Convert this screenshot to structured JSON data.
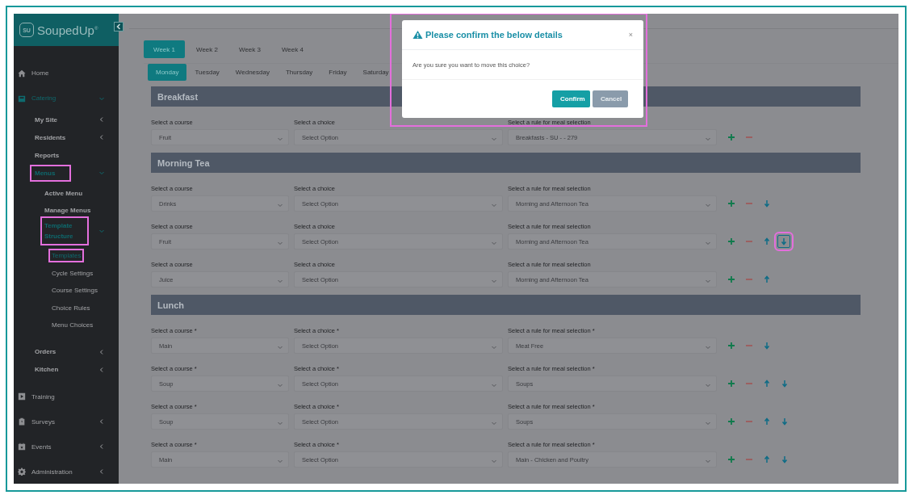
{
  "logo": {
    "badge": "SU",
    "name": "SoupedUp",
    "mark": "®"
  },
  "sidebar": {
    "items": [
      {
        "label": "Home",
        "active": false
      },
      {
        "label": "Catering",
        "active": true,
        "expanded": true,
        "children": [
          {
            "label": "My Site",
            "active": false,
            "expanded": false
          },
          {
            "label": "Residents",
            "active": false,
            "expanded": false
          },
          {
            "label": "Reports",
            "active": false
          },
          {
            "label": "Menus",
            "active": true,
            "expanded": true,
            "highlighted": true,
            "children": [
              {
                "label": "Active Menu",
                "active": false
              },
              {
                "label": "Manage Menus",
                "active": false
              },
              {
                "label": "Template Structure",
                "active": true,
                "expanded": true,
                "highlighted": true,
                "children": [
                  {
                    "label": "Templates",
                    "active": true,
                    "highlighted": true
                  },
                  {
                    "label": "Cycle Settings",
                    "active": false
                  },
                  {
                    "label": "Course Settings",
                    "active": false
                  },
                  {
                    "label": "Choice Rules",
                    "active": false
                  },
                  {
                    "label": "Menu Choices",
                    "active": false
                  }
                ]
              }
            ]
          },
          {
            "label": "Orders",
            "active": false,
            "expanded": false
          },
          {
            "label": "Kitchen",
            "active": false,
            "expanded": false
          }
        ]
      },
      {
        "label": "Training",
        "active": false
      },
      {
        "label": "Surveys",
        "active": false,
        "expanded": false
      },
      {
        "label": "Events",
        "active": false,
        "expanded": false
      },
      {
        "label": "Administration",
        "active": false,
        "expanded": false
      }
    ]
  },
  "week_tabs": [
    {
      "label": "Week 1",
      "selected": true
    },
    {
      "label": "Week 2",
      "selected": false
    },
    {
      "label": "Week 3",
      "selected": false
    },
    {
      "label": "Week 4",
      "selected": false
    }
  ],
  "day_tabs": [
    {
      "label": "Monday",
      "selected": true
    },
    {
      "label": "Tuesday",
      "selected": false
    },
    {
      "label": "Wednesday",
      "selected": false
    },
    {
      "label": "Thursday",
      "selected": false
    },
    {
      "label": "Friday",
      "selected": false
    },
    {
      "label": "Saturday",
      "selected": false
    }
  ],
  "sections": [
    {
      "title": "Breakfast",
      "rows": [
        {
          "course_label": "Select a course",
          "course": "Fruit",
          "choice_label": "Select a choice",
          "choice": "Select Option",
          "rule_label": "Select a rule for meal selection",
          "rule": "Breakfasts - SU - - 279",
          "actions": [
            {
              "kind": "add"
            },
            {
              "kind": "remove"
            }
          ]
        }
      ]
    },
    {
      "title": "Morning Tea",
      "rows": [
        {
          "course_label": "Select a course",
          "course": "Drinks",
          "choice_label": "Select a choice",
          "choice": "Select Option",
          "rule_label": "Select a rule for meal selection",
          "rule": "Morning and Afternoon Tea",
          "actions": [
            {
              "kind": "add"
            },
            {
              "kind": "remove"
            },
            {
              "kind": "down"
            }
          ]
        },
        {
          "course_label": "Select a course",
          "course": "Fruit",
          "choice_label": "Select a choice",
          "choice": "Select Option",
          "rule_label": "Select a rule for meal selection",
          "rule": "Morning and Afternoon Tea",
          "actions": [
            {
              "kind": "add"
            },
            {
              "kind": "remove"
            },
            {
              "kind": "up"
            },
            {
              "kind": "down",
              "highlighted": true
            }
          ]
        },
        {
          "course_label": "Select a course",
          "course": "Juice",
          "choice_label": "Select a choice",
          "choice": "Select Option",
          "rule_label": "Select a rule for meal selection",
          "rule": "Morning and Afternoon Tea",
          "actions": [
            {
              "kind": "add"
            },
            {
              "kind": "remove"
            },
            {
              "kind": "up"
            }
          ]
        }
      ]
    },
    {
      "title": "Lunch",
      "rows": [
        {
          "course_label": "Select a course *",
          "course": "Main",
          "choice_label": "Select a choice *",
          "choice": "Select Option",
          "rule_label": "Select a rule for meal selection *",
          "rule": "Meat Free",
          "actions": [
            {
              "kind": "add"
            },
            {
              "kind": "remove"
            },
            {
              "kind": "down"
            }
          ]
        },
        {
          "course_label": "Select a course *",
          "course": "Soup",
          "choice_label": "Select a choice *",
          "choice": "Select Option",
          "rule_label": "Select a rule for meal selection *",
          "rule": "Soups",
          "actions": [
            {
              "kind": "add"
            },
            {
              "kind": "remove"
            },
            {
              "kind": "up"
            },
            {
              "kind": "down"
            }
          ]
        },
        {
          "course_label": "Select a course *",
          "course": "Soup",
          "choice_label": "Select a choice *",
          "choice": "Select Option",
          "rule_label": "Select a rule for meal selection *",
          "rule": "Soups",
          "actions": [
            {
              "kind": "add"
            },
            {
              "kind": "remove"
            },
            {
              "kind": "up"
            },
            {
              "kind": "down"
            }
          ]
        },
        {
          "course_label": "Select a course *",
          "course": "Main",
          "choice_label": "Select a choice *",
          "choice": "Select Option",
          "rule_label": "Select a rule for meal selection *",
          "rule": "Main - Chicken and Poultry",
          "actions": [
            {
              "kind": "add"
            },
            {
              "kind": "remove"
            },
            {
              "kind": "up"
            },
            {
              "kind": "down"
            }
          ]
        }
      ]
    }
  ],
  "dialog": {
    "title": "Please confirm the below details",
    "close": "×",
    "message": "Are you sure you want to move this choice?",
    "highlighted": true,
    "buttons": [
      {
        "label": "Confirm",
        "kind": "primary"
      },
      {
        "label": "Cancel",
        "kind": "secondary"
      }
    ]
  }
}
